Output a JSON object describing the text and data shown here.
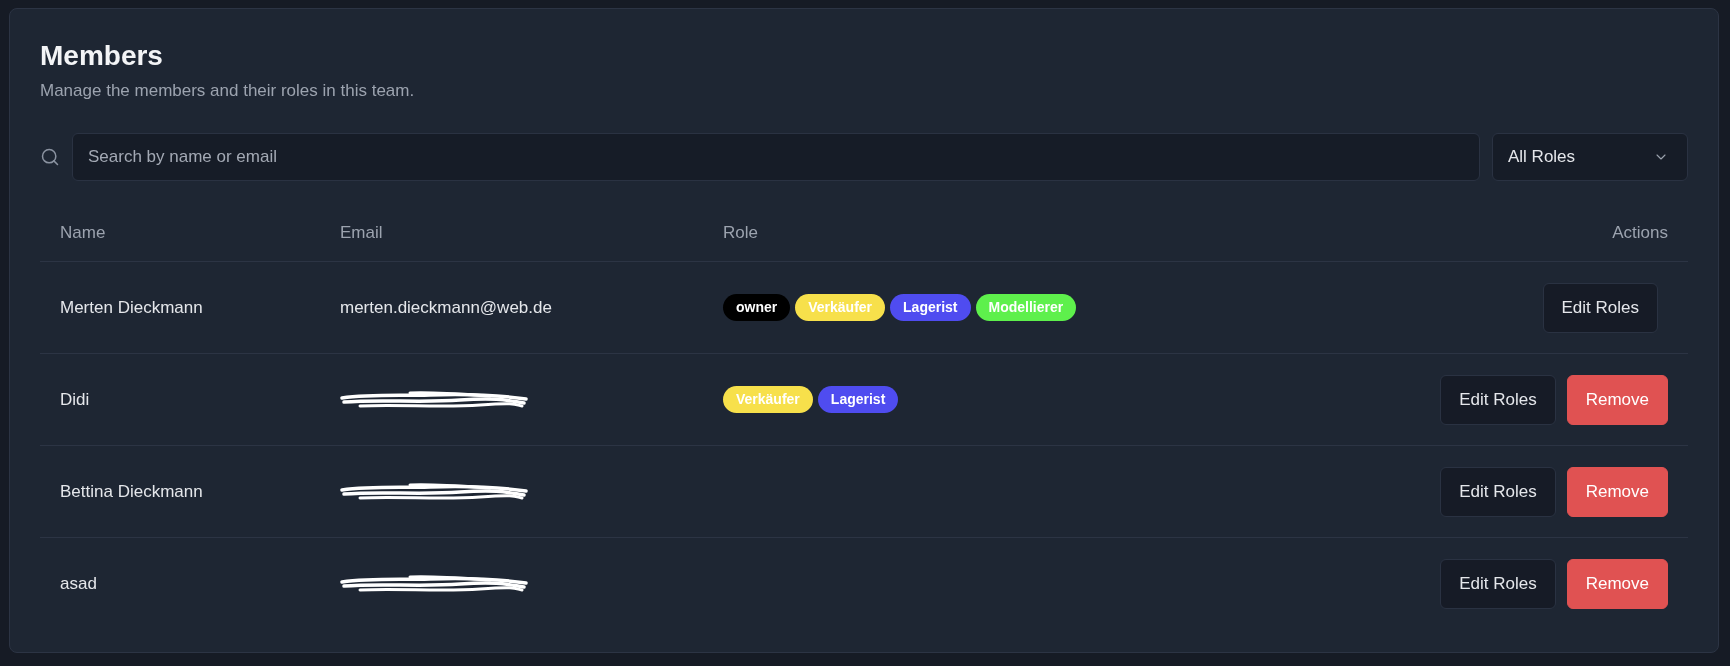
{
  "header": {
    "title": "Members",
    "subtitle": "Manage the members and their roles in this team."
  },
  "search": {
    "placeholder": "Search by name or email"
  },
  "role_filter": {
    "value": "All Roles"
  },
  "table": {
    "columns": [
      "Name",
      "Email",
      "Role",
      "Actions"
    ],
    "rows": [
      {
        "name": "Merten Dieckmann",
        "email": "merten.dieckmann@web.de",
        "email_redacted": false,
        "roles": [
          {
            "label": "owner",
            "color": "#000000"
          },
          {
            "label": "Verkäufer",
            "color": "#f7e04b"
          },
          {
            "label": "Lagerist",
            "color": "#4f4cf0"
          },
          {
            "label": "Modellierer",
            "color": "#5ef04c"
          }
        ],
        "actions": [
          {
            "label": "Edit Roles",
            "kind": "secondary"
          }
        ]
      },
      {
        "name": "Didi",
        "email_redacted": true,
        "roles": [
          {
            "label": "Verkäufer",
            "color": "#f7e04b"
          },
          {
            "label": "Lagerist",
            "color": "#4f4cf0"
          }
        ],
        "actions": [
          {
            "label": "Edit Roles",
            "kind": "secondary"
          },
          {
            "label": "Remove",
            "kind": "danger"
          }
        ]
      },
      {
        "name": "Bettina Dieckmann",
        "email_redacted": true,
        "roles": [],
        "actions": [
          {
            "label": "Edit Roles",
            "kind": "secondary"
          },
          {
            "label": "Remove",
            "kind": "danger"
          }
        ]
      },
      {
        "name": "asad",
        "email_redacted": true,
        "roles": [],
        "actions": [
          {
            "label": "Edit Roles",
            "kind": "secondary"
          },
          {
            "label": "Remove",
            "kind": "danger"
          }
        ]
      }
    ]
  }
}
